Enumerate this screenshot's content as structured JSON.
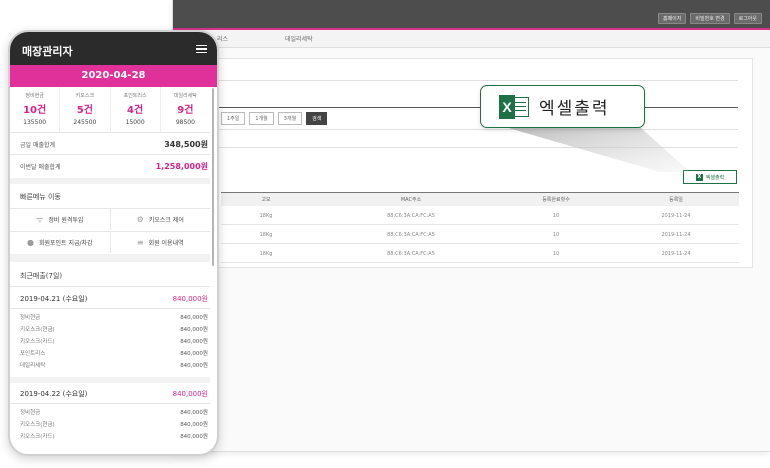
{
  "desktop": {
    "topbar_buttons": [
      "홈페이지",
      "비밀번호 변경",
      "로그아웃"
    ],
    "tabs": [
      "리스",
      "데일리세탁"
    ],
    "period_buttons": [
      "1주일",
      "1개월",
      "3개월",
      "검색"
    ],
    "excel_button": "엑셀출력",
    "table": {
      "headers": [
        "고모",
        "MAC주소",
        "등록완료횟수",
        "등록일"
      ],
      "rows": [
        [
          "18Kg",
          "88:C6:3A:CA:FC:A5",
          "10",
          "2019-11-24"
        ],
        [
          "18Kg",
          "88:C6:3A:CA:FC:A5",
          "10",
          "2019-11-24"
        ],
        [
          "18Kg",
          "88:C6:3A:CA:FC:A5",
          "10",
          "2019-11-24"
        ]
      ]
    }
  },
  "callout": {
    "label": "엑셀출력",
    "icon": "excel-icon"
  },
  "phone": {
    "title": "매장관리자",
    "date": "2020-04-28",
    "stats": [
      {
        "label": "정비현금",
        "count": "10건",
        "amount": "135500"
      },
      {
        "label": "키오스크",
        "count": "5건",
        "amount": "245500"
      },
      {
        "label": "포인트리스",
        "count": "4건",
        "amount": "15000"
      },
      {
        "label": "데일리세탁",
        "count": "9건",
        "amount": "98500"
      }
    ],
    "today_sales_label": "금일 매출합계",
    "today_sales_value": "348,500원",
    "month_sales_label": "이번달 매출합계",
    "month_sales_value": "1,258,000원",
    "quick_menu_title": "빠른메뉴 이동",
    "quick_menu": [
      {
        "label": "정비 원격투입",
        "icon": "wifi-icon"
      },
      {
        "label": "키오스크 제어",
        "icon": "gear-icon"
      },
      {
        "label": "회원포인트 지급/차감",
        "icon": "person-icon"
      },
      {
        "label": "회원 이용내역",
        "icon": "list-icon"
      }
    ],
    "recent_title": "최근매출(7일)",
    "days": [
      {
        "date": "2019-04.21 (수요일)",
        "total": "840,000원",
        "items": [
          {
            "name": "정비현금",
            "amount": "840,000원"
          },
          {
            "name": "키오스크(현금)",
            "amount": "840,000원"
          },
          {
            "name": "키오스크(카드)",
            "amount": "840,000원"
          },
          {
            "name": "포인트리스",
            "amount": "840,000원"
          },
          {
            "name": "데일리세탁",
            "amount": "840,000원"
          }
        ]
      },
      {
        "date": "2019-04.22 (수요일)",
        "total": "840,000원",
        "items": [
          {
            "name": "정비현금",
            "amount": "840,000원"
          },
          {
            "name": "키오스크(현금)",
            "amount": "840,000원"
          },
          {
            "name": "키오스크(카드)",
            "amount": "840,000원"
          }
        ]
      }
    ]
  }
}
